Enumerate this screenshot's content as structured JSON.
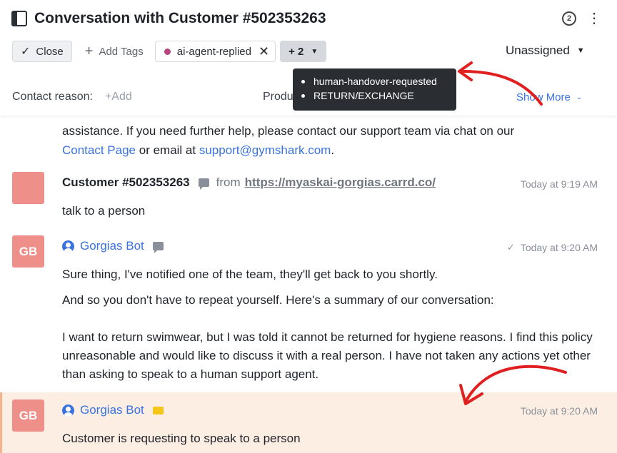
{
  "header": {
    "title": "Conversation with Customer #502353263",
    "close_label": "Close",
    "add_tags_label": "Add Tags",
    "tag_label": "ai-agent-replied",
    "more_tags_label": "+ 2",
    "assignee_label": "Unassigned",
    "snooze_badge": "2",
    "contact_reason_label": "Contact reason:",
    "contact_reason_add": "+Add",
    "product_label": "Product",
    "show_more_label": "Show More"
  },
  "tooltip": {
    "items": [
      "human-handover-requested",
      "RETURN/EXCHANGE"
    ]
  },
  "messages": {
    "prev_tail_line1": "assistance. If you need further help, please contact our support team via chat on our",
    "prev_contact_page": "Contact Page",
    "prev_or_email": " or email at ",
    "prev_email": "support@gymshark.com",
    "prev_period": ".",
    "m1": {
      "sender": "Customer #502353263",
      "from_label": "from",
      "url": "https://myaskai-gorgias.carrd.co/",
      "time": "Today at 9:19 AM",
      "text": "talk to a person"
    },
    "m2": {
      "avatar": "GB",
      "sender": "Gorgias Bot",
      "time": "Today at 9:20 AM",
      "p1": "Sure thing, I've notified one of the team, they'll get back to you shortly.",
      "p2": "And so you don't have to repeat yourself. Here's a summary of our conversation:",
      "p3": "I want to return swimwear, but I was told it cannot be returned for hygiene reasons. I find this policy unreasonable and would like to discuss it with a real person. I have not taken any actions yet other than asking to speak to a human support agent."
    },
    "m3": {
      "avatar": "GB",
      "sender": "Gorgias Bot",
      "time": "Today at 9:20 AM",
      "text": "Customer is requesting to speak to a person"
    }
  },
  "colors": {
    "link": "#3a72e0",
    "avatar": "#ef8f8a",
    "tag_dot": "#b8437f",
    "internal_note_bg": "#fdeee4",
    "annotation_arrow": "#e02020"
  }
}
